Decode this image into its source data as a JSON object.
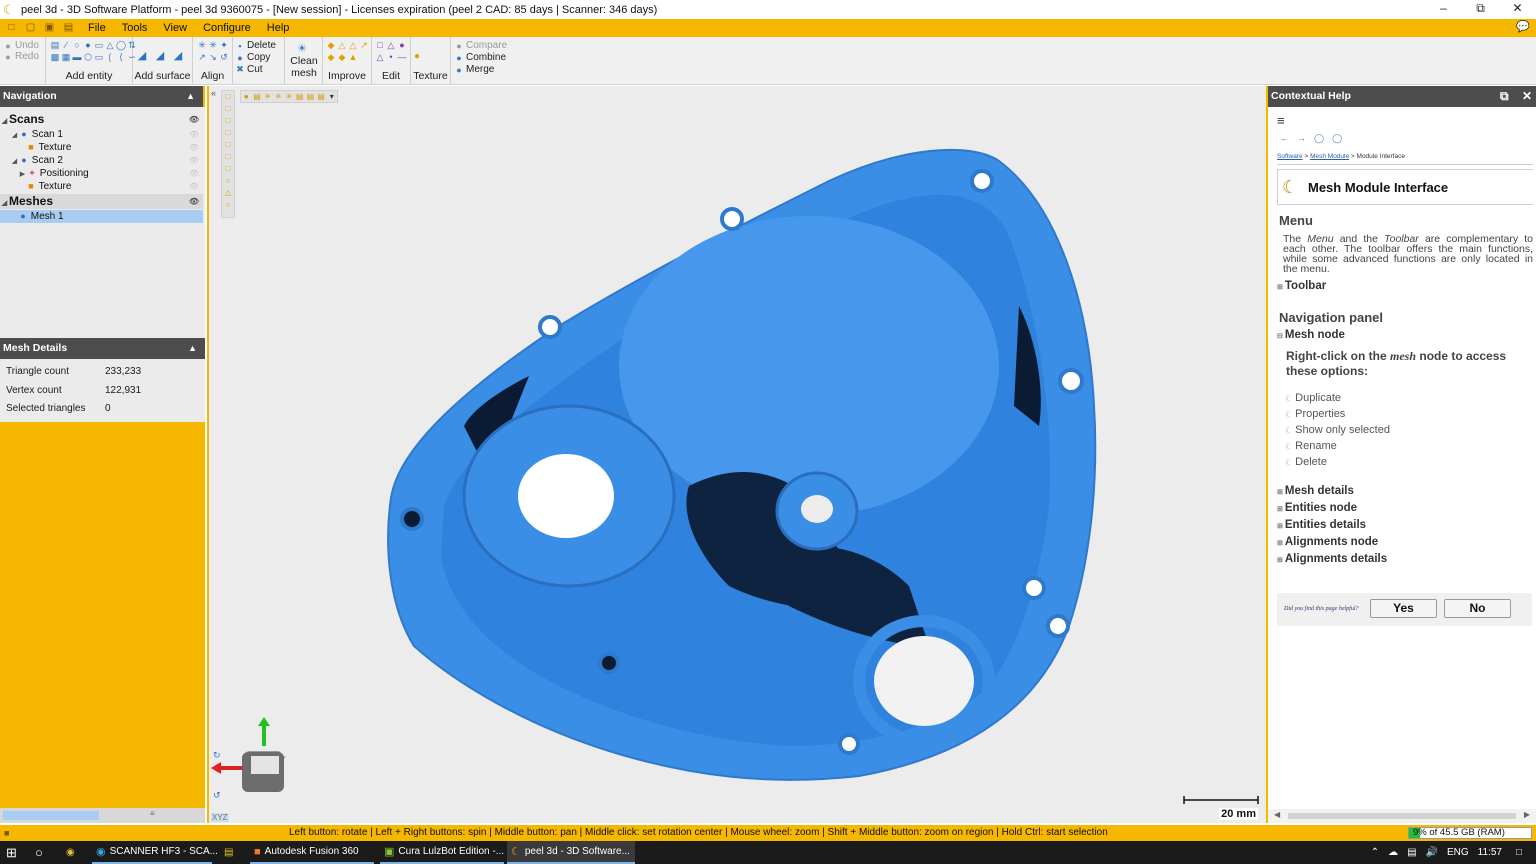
{
  "window": {
    "title": "peel 3d - 3D Software Platform - peel 3d 9360075 - [New session] - Licenses expiration (peel 2 CAD: 85 days | Scanner: 346 days)"
  },
  "menubar": {
    "items": [
      "File",
      "Tools",
      "View",
      "Configure",
      "Help"
    ]
  },
  "ribbon": {
    "undo": "Undo",
    "redo": "Redo",
    "groups": {
      "add_entity": "Add entity",
      "add_surface": "Add surface",
      "align": "Align",
      "clean_mesh_1": "Clean",
      "clean_mesh_2": "mesh",
      "improve": "Improve",
      "edit": "Edit",
      "texture": "Texture"
    },
    "edit_ops": [
      "Delete",
      "Copy",
      "Cut"
    ],
    "combine_ops": [
      "Compare",
      "Combine",
      "Merge"
    ]
  },
  "navigation": {
    "title": "Navigation",
    "tree": [
      {
        "label": "Scans"
      },
      {
        "label": "Scan 1"
      },
      {
        "label": "Texture"
      },
      {
        "label": "Scan 2"
      },
      {
        "label": "Positioning"
      },
      {
        "label": "Texture"
      },
      {
        "label": "Meshes"
      },
      {
        "label": "Mesh 1"
      }
    ]
  },
  "mesh_details": {
    "title": "Mesh Details",
    "rows": [
      {
        "label": "Triangle count",
        "value": "233,233"
      },
      {
        "label": "Vertex count",
        "value": "122,931"
      },
      {
        "label": "Selected triangles",
        "value": "0"
      }
    ]
  },
  "viewport": {
    "scale_label": "20 mm",
    "axes_label": "XYZ",
    "mesh_color": "#3b8ee6"
  },
  "help": {
    "title": "Contextual Help",
    "breadcrumb": {
      "a": "Software",
      "b": "Mesh Module",
      "c": "Module Interface",
      "sep": ">"
    },
    "page_title": "Mesh Module Interface",
    "menu_heading": "Menu",
    "menu_para_1": "The ",
    "menu_para_menu": "Menu",
    "menu_para_2": " and the ",
    "menu_para_toolbar": "Toolbar",
    "menu_para_3": " are complementary to each other. The toolbar offers the main functions, while some advanced functions are only located in the menu.",
    "toolbar_link": "Toolbar",
    "nav_heading": "Navigation panel",
    "mesh_node": "Mesh node",
    "rightclick_1": "Right-click on the ",
    "rightclick_em": "mesh",
    "rightclick_2": " node to access these options:",
    "options": [
      "Duplicate",
      "Properties",
      "Show only selected",
      "Rename",
      "Delete"
    ],
    "more_sections": [
      "Mesh details",
      "Entities node",
      "Entities details",
      "Alignments node",
      "Alignments details"
    ],
    "feedback_q": "Did you find this page helpful?",
    "yes": "Yes",
    "no": "No"
  },
  "statusbar": {
    "hints": "Left button: rotate  |  Left + Right buttons: spin  |  Middle button: pan  |  Middle click: set rotation center  |  Mouse wheel: zoom  |  Shift + Middle button: zoom on region  |  Hold Ctrl: start selection",
    "ram": "9% of 45.5 GB (RAM)",
    "ram_fraction": 0.09
  },
  "taskbar": {
    "items": [
      "SCANNER HF3 - SCA...",
      "Autodesk Fusion 360",
      "Cura LulzBot Edition -...",
      "peel 3d - 3D Software..."
    ],
    "lang": "ENG",
    "time": "11:57"
  }
}
